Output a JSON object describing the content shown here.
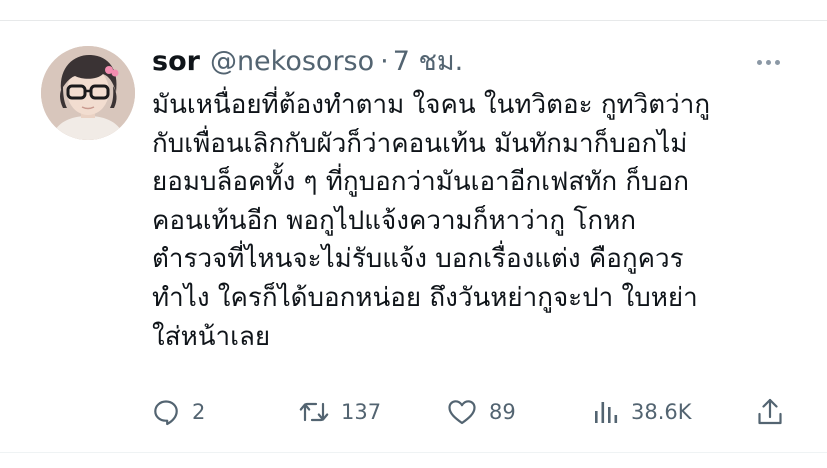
{
  "tweet": {
    "author": {
      "display_name": "sor",
      "handle": "@nekosorso",
      "separator": "·",
      "time": "7 ชม."
    },
    "text_lines": [
      "มันเหนื่อยที่ต้องทำตาม ใจคน ในทวิตอะ กูทวิตว่ากู",
      "กับเพื่อนเลิกกับผัวก็ว่าคอนเท้น มันทักมาก็บอกไม่",
      "ยอมบล็อคทั้ง ๆ ที่กูบอกว่ามันเอาอีกเฟสทัก ก็บอก",
      "คอนเท้นอีก พอกูไปแจ้งความก็หาว่ากู โกหก",
      "ตำรวจที่ไหนจะไม่รับแจ้ง บอกเรื่องแต่ง คือกูควร",
      "ทำไง ใครก็ได้บอกหน่อย ถึงวันหย่ากูจะปา ใบหย่า",
      "ใส่หน้าเลย"
    ],
    "actions": {
      "replies": "2",
      "retweets": "137",
      "likes": "89",
      "views": "38.6K"
    },
    "icons": {
      "reply": "reply-icon",
      "retweet": "retweet-icon",
      "like": "heart-icon",
      "views": "views-icon",
      "share": "share-icon",
      "more": "more-options-icon"
    },
    "colors": {
      "text": "#0f1419",
      "secondary": "#536471",
      "divider": "#e7e9ea"
    }
  }
}
